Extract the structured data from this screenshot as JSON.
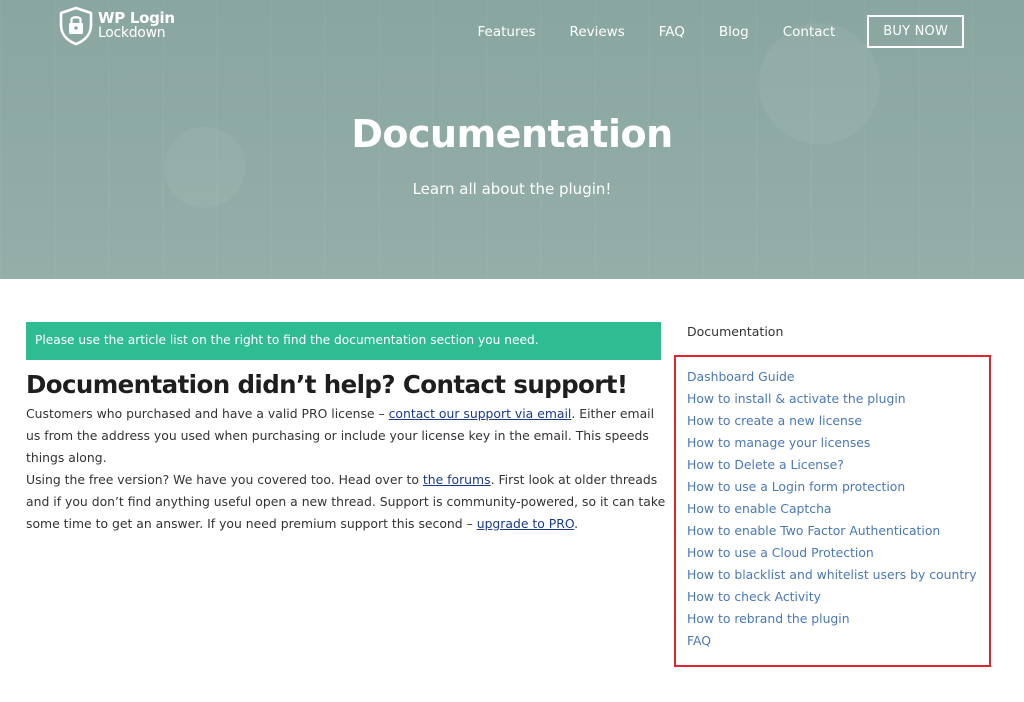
{
  "brand": {
    "line1": "WP Login",
    "line2": "Lockdown"
  },
  "nav": {
    "items": [
      "Features",
      "Reviews",
      "FAQ",
      "Blog",
      "Contact"
    ],
    "buy_label": "BUY NOW"
  },
  "hero": {
    "title": "Documentation",
    "subtitle": "Learn all about the plugin!"
  },
  "main": {
    "notice": "Please use the article list on the right to find the documentation section you need.",
    "support_title": "Documentation didn’t help? Contact support!",
    "para1_before": "Customers who purchased and have a valid PRO license – ",
    "para1_link": "contact our support via email",
    "para1_after": ". Either email us from the address you used when purchasing or include your license key in the email. This speeds things along.",
    "para2_before": "Using the free version? We have you covered too. Head over to ",
    "para2_link1": "the forums",
    "para2_middle": ". First look at older threads and if you don’t find anything useful open a new thread. Support is community-powered, so it can take some time to get an answer. If you need premium support this second – ",
    "para2_link2": "upgrade to PRO",
    "para2_after": "."
  },
  "sidebar": {
    "heading": "Documentation",
    "items": [
      "Dashboard Guide",
      "How to install & activate the plugin",
      "How to create a new license",
      "How to manage your licenses",
      "How to Delete a License?",
      "How to use a Login form protection",
      "How to enable Captcha",
      "How to enable Two Factor Authentication",
      "How to use a Cloud Protection",
      "How to blacklist and whitelist users by country",
      "How to check Activity",
      "How to rebrand the plugin",
      "FAQ"
    ]
  },
  "colors": {
    "hero_bg": "#8ea9a4",
    "notice_bg": "#2ebc92",
    "link": "#4a78b4",
    "highlight_border": "#e0262b"
  },
  "icons": {
    "logo": "shield-lock-icon"
  }
}
